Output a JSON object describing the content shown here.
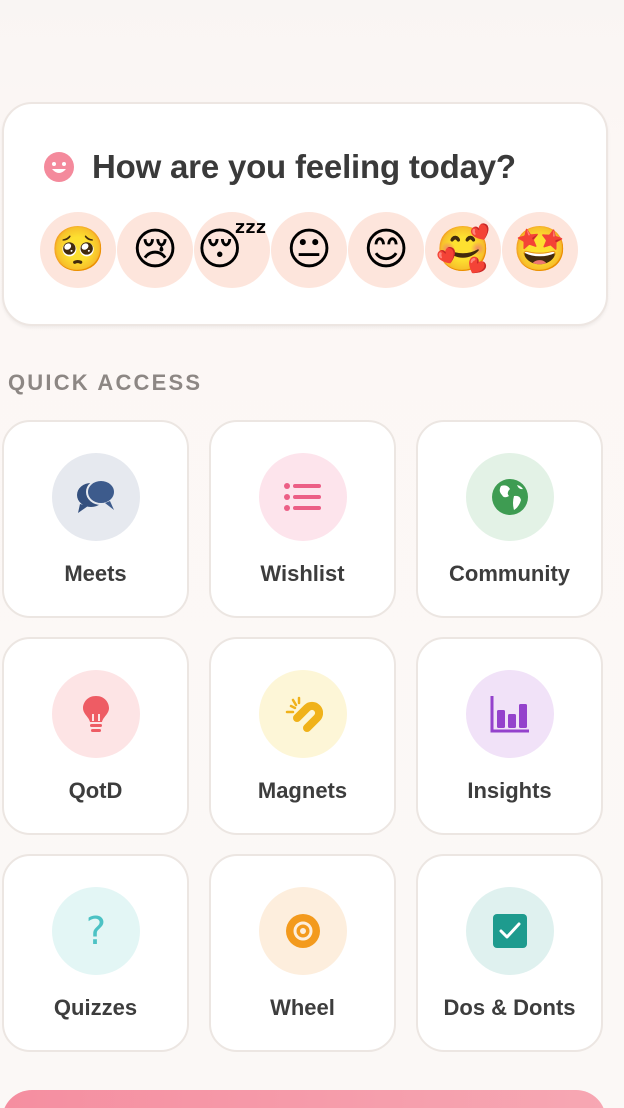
{
  "mood": {
    "title": "How are you feeling today?",
    "icon": "smile-icon",
    "options": [
      {
        "emoji": "🥺",
        "name": "pleading-face"
      },
      {
        "emoji": "😢",
        "name": "crying-face"
      },
      {
        "emoji": "😴",
        "name": "sleeping-face"
      },
      {
        "emoji": "😐",
        "name": "neutral-face"
      },
      {
        "emoji": "😊",
        "name": "smiling-face"
      },
      {
        "emoji": "🥰",
        "name": "smiling-face-with-hearts"
      },
      {
        "emoji": "🤩",
        "name": "star-struck"
      }
    ]
  },
  "quick_access": {
    "title": "QUICK ACCESS",
    "items": [
      {
        "label": "Meets",
        "icon": "chat-bubbles-icon",
        "bg": "#e6e9ef",
        "color": "#34507e"
      },
      {
        "label": "Wishlist",
        "icon": "list-icon",
        "bg": "#fde4ec",
        "color": "#ec5f86"
      },
      {
        "label": "Community",
        "icon": "globe-icon",
        "bg": "#e3f2e6",
        "color": "#3e9c52"
      },
      {
        "label": "QotD",
        "icon": "lightbulb-icon",
        "bg": "#fde4e5",
        "color": "#ee5c64"
      },
      {
        "label": "Magnets",
        "icon": "magnet-icon",
        "bg": "#fdf6d7",
        "color": "#f0b21a"
      },
      {
        "label": "Insights",
        "icon": "bar-chart-icon",
        "bg": "#f1e2f8",
        "color": "#9442cc"
      },
      {
        "label": "Quizzes",
        "icon": "question-icon",
        "bg": "#e3f6f5",
        "color": "#4cc2c4"
      },
      {
        "label": "Wheel",
        "icon": "wheel-icon",
        "bg": "#fdeedd",
        "color": "#f39a1d"
      },
      {
        "label": "Dos & Donts",
        "icon": "checkbox-icon",
        "bg": "#dff1ef",
        "color": "#1e9b8e"
      }
    ]
  }
}
